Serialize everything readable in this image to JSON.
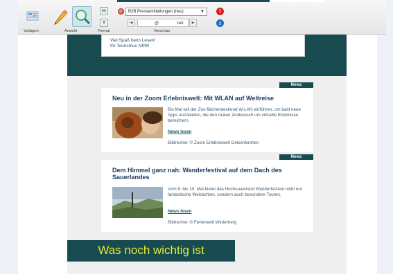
{
  "toolbar": {
    "groups": {
      "templates": "Vorlagen",
      "view": "Ansicht",
      "format": "Format",
      "preview": "Vorschau"
    },
    "format_buttons": {
      "h": "H",
      "t": "T"
    },
    "preview_select": "B2B Pressemitteilungen (neu)",
    "page_field": {
      "at": "@",
      "unit": "zeit."
    },
    "alert_icon": "!",
    "info_icon": "i",
    "colors": {
      "accent": "#174b50",
      "alert": "#d62020",
      "info": "#1c6fc4"
    }
  },
  "greeting": {
    "line1": "Viel Spaß beim Lesen!",
    "line2": "Ihr Tourismus NRW"
  },
  "articles": [
    {
      "tag": "News",
      "title": "Neu in der Zoom Erlebniswelt: Mit WLAN auf Weltreise",
      "body": "Bis Mai will der Zoo flächendeckend W-LAN einführen, um bald neue Apps anzubieten, die den realen Zoobesuch um virtuelle Erlebnisse bereichern.",
      "more": "News lesen",
      "credit": "Bildrechte: © Zoom Erlebniswelt Gelsenkirchen"
    },
    {
      "tag": "News",
      "title": "Dem Himmel ganz nah: Wanderfestival auf dem Dach des Sauerlandes",
      "body": "Vom 8. bis 10. Mai bietet das Hochsauerland Wanderfestival nicht nur fantastische Weitsichten, sondern auch besondere Touren.",
      "more": "News lesen",
      "credit": "Bildrechte: © Ferienwelt Winterberg"
    }
  ],
  "section_heading": "Was noch wichtig ist",
  "section_colors": {
    "band": "#174b50",
    "heading_text": "#e2e836"
  }
}
